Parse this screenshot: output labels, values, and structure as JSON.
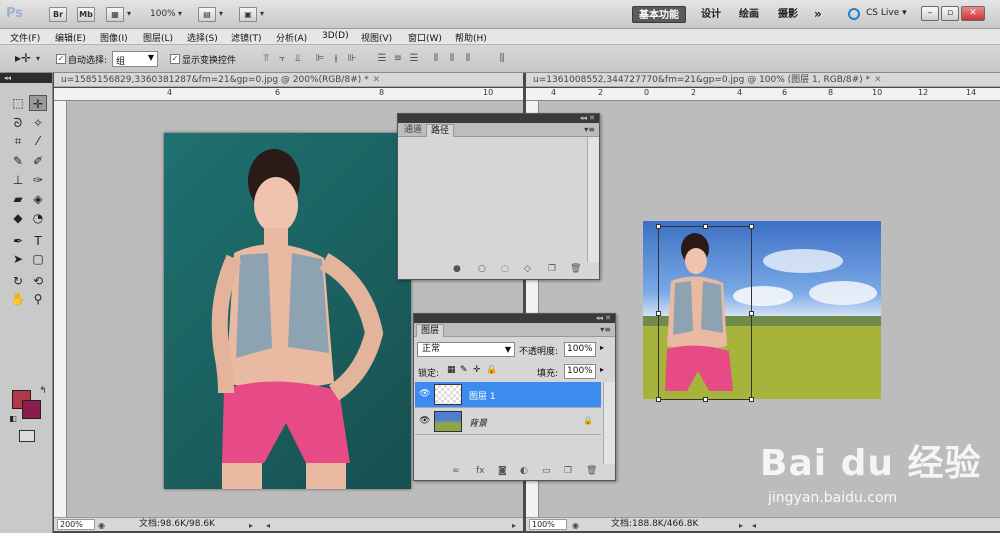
{
  "app": {
    "logo": "Ps",
    "launchers": [
      "Br",
      "Mb"
    ],
    "zoom": "100%",
    "workspaces": {
      "active": "基本功能",
      "design": "设计",
      "painting": "绘画",
      "photography": "摄影",
      "more": "»"
    },
    "cs_live": "CS Live",
    "window_buttons": {
      "minimize": "–",
      "restore": "▫",
      "close": "✕"
    }
  },
  "menu": [
    "文件(F)",
    "编辑(E)",
    "图像(I)",
    "图层(L)",
    "选择(S)",
    "滤镜(T)",
    "分析(A)",
    "3D(D)",
    "视图(V)",
    "窗口(W)",
    "帮助(H)"
  ],
  "options": {
    "auto_select_label": "自动选择:",
    "auto_select_checked": true,
    "auto_select_value": "组",
    "show_transform_label": "显示变换控件",
    "show_transform_checked": true
  },
  "documents": [
    {
      "title": "u=1585156829,3360381287&fm=21&gp=0.jpg @ 200%(RGB/8#) *",
      "zoom": "200%",
      "doc_size": "文档:98.6K/98.6K",
      "ruler": [
        "4",
        "6",
        "8",
        "10"
      ]
    },
    {
      "title": "u=1361008552,344727770&fm=21&gp=0.jpg @ 100% (图层 1, RGB/8#) *",
      "zoom": "100%",
      "doc_size": "文档:188.8K/466.8K",
      "ruler": [
        "4",
        "2",
        "0",
        "2",
        "4",
        "6",
        "8",
        "10",
        "12",
        "14"
      ]
    }
  ],
  "channels_panel": {
    "tabs": [
      "通道",
      "路径"
    ],
    "active_tab": "路径"
  },
  "layers_panel": {
    "tab": "图层",
    "blend_mode": "正常",
    "opacity_label": "不透明度:",
    "opacity": "100%",
    "lock_label": "锁定:",
    "fill_label": "填充:",
    "fill": "100%",
    "layers": [
      {
        "name": "图层 1",
        "selected": true
      },
      {
        "name": "背景",
        "selected": false,
        "locked": true
      }
    ]
  },
  "colors": {
    "foreground": "#b03a48",
    "background": "#8d1c4e",
    "accent": "#3c8cf0"
  },
  "watermark": {
    "logo": "Bai du 经验",
    "url": "jingyan.baidu.com"
  }
}
